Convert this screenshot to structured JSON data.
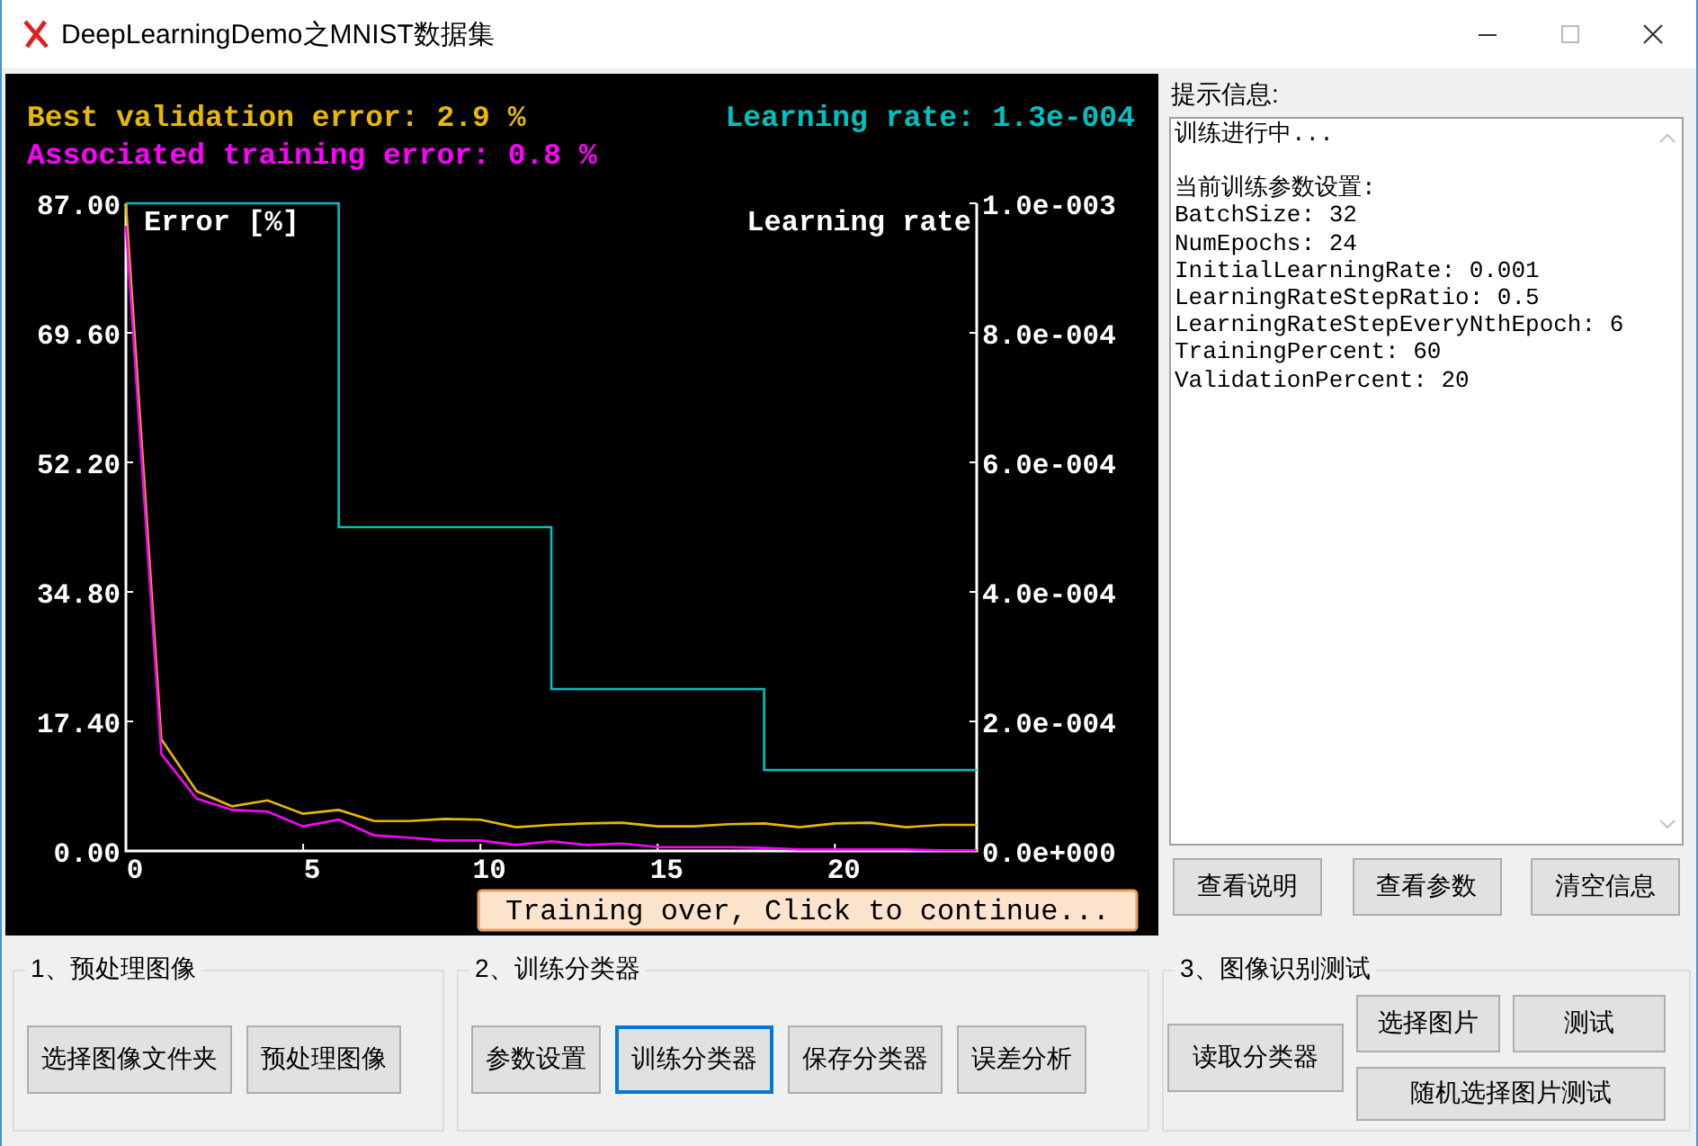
{
  "window": {
    "title": "DeepLearningDemo之MNIST数据集"
  },
  "plot": {
    "best_validation": "Best validation error: 2.9 %",
    "training_error": "Associated training error: 0.8 %",
    "learning_rate": "Learning rate: 1.3e-004",
    "left_axis_title": "Error [%]",
    "right_axis_title": "Learning rate",
    "continue_button": "Training over, Click to continue...",
    "chart_data": {
      "type": "line",
      "x": [
        0,
        1,
        2,
        3,
        4,
        5,
        6,
        7,
        8,
        9,
        10,
        11,
        12,
        13,
        14,
        15,
        16,
        17,
        18,
        19,
        20,
        21,
        22,
        23,
        24
      ],
      "xlim": [
        0,
        24
      ],
      "xticks": [
        0,
        5,
        10,
        15,
        20
      ],
      "ylim": [
        0,
        87
      ],
      "yticks": [
        {
          "value": 0,
          "label": "0.00"
        },
        {
          "value": 17.4,
          "label": "17.40"
        },
        {
          "value": 34.8,
          "label": "34.80"
        },
        {
          "value": 52.2,
          "label": "52.20"
        },
        {
          "value": 69.6,
          "label": "69.60"
        },
        {
          "value": 87,
          "label": "87.00"
        }
      ],
      "y2lim": [
        0,
        0.001
      ],
      "y2ticks": [
        {
          "value": 0,
          "label": "0.0e+000"
        },
        {
          "value": 0.0002,
          "label": "2.0e-004"
        },
        {
          "value": 0.0004,
          "label": "4.0e-004"
        },
        {
          "value": 0.0006,
          "label": "6.0e-004"
        },
        {
          "value": 0.0008,
          "label": "8.0e-004"
        },
        {
          "value": 0.001,
          "label": "1.0e-003"
        }
      ],
      "series": [
        {
          "color": "#e6b800",
          "values": [
            87,
            15,
            8,
            6,
            6.8,
            5,
            5.5,
            4,
            4,
            4.3,
            4.2,
            3.2,
            3.5,
            3.7,
            3.8,
            3.3,
            3.3,
            3.6,
            3.7,
            3.2,
            3.7,
            3.8,
            3.2,
            3.5,
            3.5
          ]
        },
        {
          "color": "#ff00ff",
          "values": [
            84,
            13,
            7,
            5.5,
            5.3,
            3.3,
            4.2,
            2.1,
            1.8,
            1.4,
            1.4,
            0.8,
            1.3,
            0.8,
            1,
            0.5,
            0.5,
            0.5,
            0.4,
            0.2,
            0.2,
            0.2,
            0.2,
            0.1,
            0.1
          ]
        },
        {
          "color": "#00c0c0",
          "axis": "y2",
          "x": [
            0,
            6,
            6,
            12,
            12,
            18,
            18,
            24
          ],
          "values": [
            0.001,
            0.001,
            0.0005,
            0.0005,
            0.00025,
            0.00025,
            0.000125,
            0.000125
          ]
        }
      ]
    }
  },
  "info": {
    "label": "提示信息:",
    "paragraphs": [
      [
        "训练进行中..."
      ],
      [
        "当前训练参数设置:",
        "BatchSize: 32",
        "NumEpochs: 24",
        "InitialLearningRate: 0.001",
        "LearningRateStepRatio: 0.5",
        "LearningRateStepEveryNthEpoch: 6",
        "TrainingPercent: 60",
        "ValidationPercent: 20"
      ]
    ]
  },
  "info_buttons": [
    "查看说明",
    "查看参数",
    "清空信息"
  ],
  "groups": [
    {
      "title": "1、预处理图像",
      "buttons": [
        {
          "label": "选择图像文件夹",
          "focused": false
        },
        {
          "label": "预处理图像",
          "focused": false
        }
      ]
    },
    {
      "title": "2、训练分类器",
      "buttons": [
        {
          "label": "参数设置",
          "focused": false
        },
        {
          "label": "训练分类器",
          "focused": true
        },
        {
          "label": "保存分类器",
          "focused": false
        },
        {
          "label": "误差分析",
          "focused": false
        }
      ]
    },
    {
      "title": "3、图像识别测试",
      "buttons": [
        {
          "label": "读取分类器",
          "focused": false
        },
        {
          "label": "选择图片",
          "focused": false
        },
        {
          "label": "测试",
          "focused": false
        },
        {
          "label": "随机选择图片测试",
          "focused": false
        }
      ]
    }
  ]
}
